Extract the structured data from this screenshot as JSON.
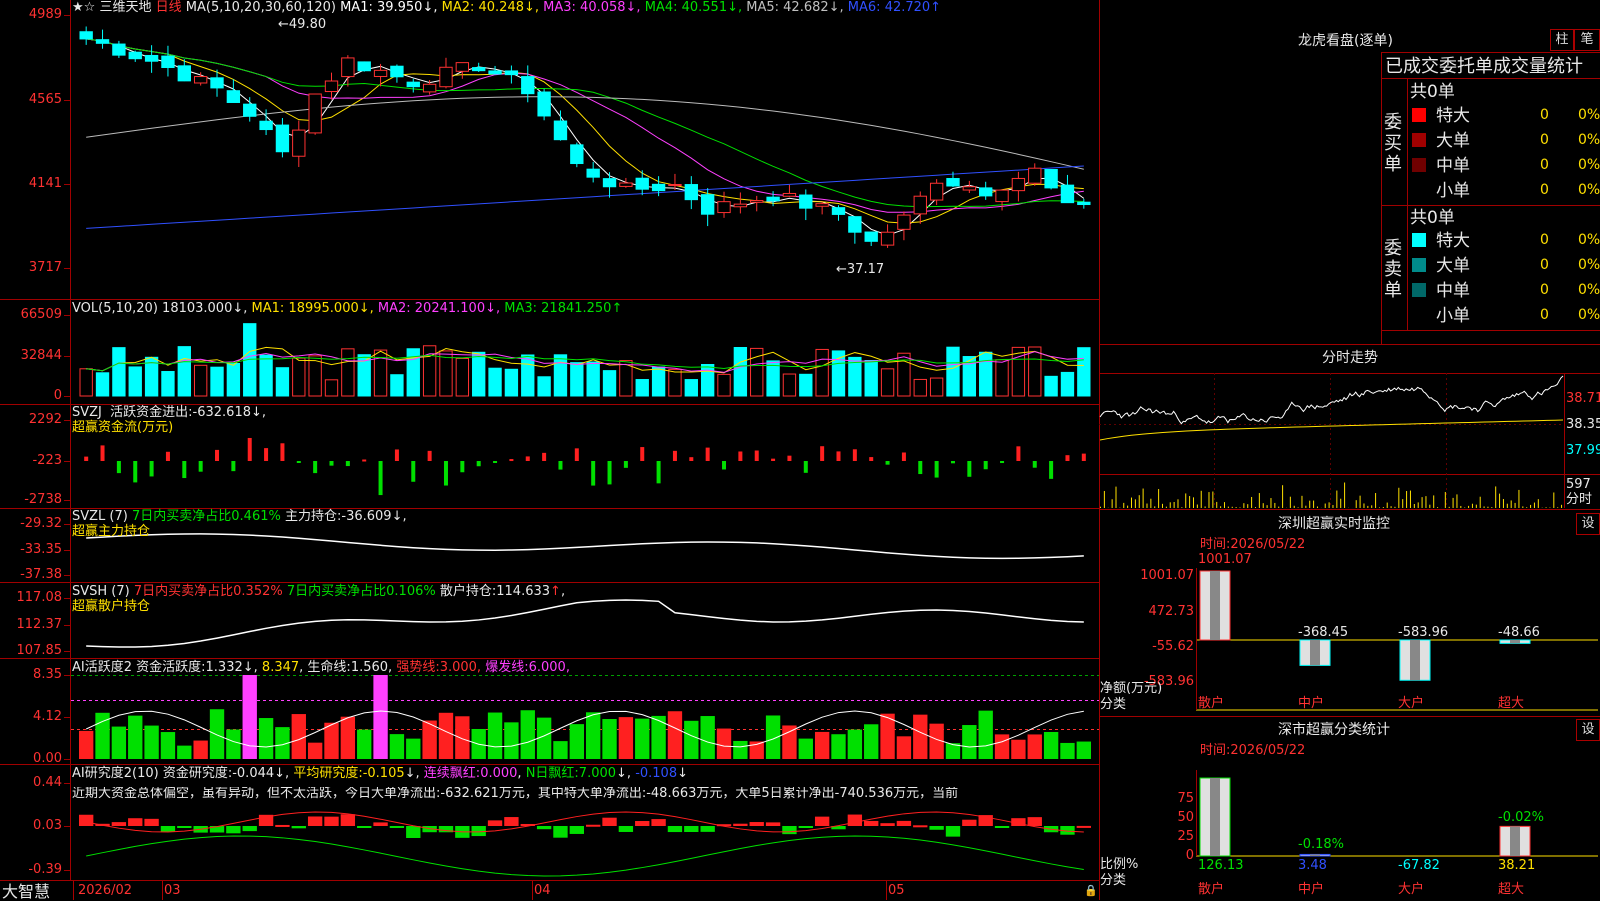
{
  "stock": {
    "name": "三维天地",
    "period": "日线",
    "star": "★",
    "star2": "☆"
  },
  "main_panel": {
    "ma_params": "MA(5,10,20,30,60,120)",
    "ma": [
      {
        "label": "MA1:",
        "value": "39.950",
        "arrow": "↓",
        "color": "#ffffff"
      },
      {
        "label": "MA2:",
        "value": "40.248",
        "arrow": "↓",
        "color": "#ffe000"
      },
      {
        "label": "MA3:",
        "value": "40.058",
        "arrow": "↓",
        "color": "#ff40ff"
      },
      {
        "label": "MA4:",
        "value": "40.551",
        "arrow": "↓",
        "color": "#00e000"
      },
      {
        "label": "MA5:",
        "value": "42.682",
        "arrow": "↓",
        "color": "#c0c0c0"
      },
      {
        "label": "MA6:",
        "value": "42.720",
        "arrow": "↑",
        "color": "#3050ff"
      }
    ],
    "yticks": [
      "4989",
      "4565",
      "4141",
      "3717"
    ],
    "high_mark": "49.80",
    "low_mark": "37.17"
  },
  "vol_panel": {
    "title": "VOL(5,10,20)",
    "value": "18103.000",
    "arrow": "↓",
    "ma": [
      {
        "label": "MA1:",
        "value": "18995.000",
        "arrow": "↓",
        "color": "#ffe000"
      },
      {
        "label": "MA2:",
        "value": "20241.100",
        "arrow": "↓",
        "color": "#ff40ff"
      },
      {
        "label": "MA3:",
        "value": "21841.250",
        "arrow": "↑",
        "color": "#00e000"
      }
    ],
    "yticks": [
      "66509",
      "32844",
      "0"
    ]
  },
  "svzj_panel": {
    "title": "SVZJ",
    "label": "活跃资金进出:",
    "value": "-632.618",
    "arrow": "↓",
    "sub": "超赢资金流(万元)",
    "yticks": [
      "2292",
      "-223",
      "-2738"
    ]
  },
  "svzl_panel": {
    "title": "SVZL (7)",
    "label1": "7日内买卖净占比",
    "value1": "0.461%",
    "label2": "主力持仓:",
    "value2": "-36.609",
    "arrow": "↓",
    "sub": "超赢主力持仓",
    "yticks": [
      "-29.32",
      "-33.35",
      "-37.38"
    ]
  },
  "svsh_panel": {
    "title": "SVSH (7)",
    "label1": "7日内买卖净占比",
    "value1": "0.352%",
    "label2": "7日内买卖净占比",
    "value2": "0.106%",
    "label3": "散户持仓:",
    "value3": "114.633",
    "arrow": "↑",
    "sub": "超赢散户持仓",
    "yticks": [
      "117.08",
      "112.37",
      "107.85"
    ]
  },
  "ai_active_panel": {
    "title": "AI活跃度2",
    "label1": "资金活跃度:",
    "value1": "1.332",
    "value2": "8.347",
    "label3": "生命线:",
    "value3": "1.560",
    "label4": "强势线:",
    "value4": "3.000",
    "label5": "爆发线:",
    "value5": "6.000",
    "yticks": [
      "8.35",
      "4.12",
      "0.00"
    ]
  },
  "ai_research_panel": {
    "title": "AI研究度2(10)",
    "label1": "资金研究度:",
    "value1": "-0.044",
    "label2": "平均研究度:",
    "value2": "-0.105",
    "label3": "连续飘红:",
    "value3": "0.000",
    "label4": "N日飘红:",
    "value4": "7.000",
    "value5": "-0.108",
    "note": "近期大资金总体偏空，虽有异动，但不太活跃，今日大单净流出:-632.621万元，其中特大单净流出:-48.663万元，大单5日累计净出-740.536万元，当前",
    "yticks": [
      "0.44",
      "0.03",
      "-0.39"
    ]
  },
  "xaxis": {
    "brand": "大智慧",
    "labels": [
      "2026/02",
      "03",
      "04",
      "05"
    ]
  },
  "lhb": {
    "title": "龙虎看盘(逐单)",
    "btn1": "柱",
    "btn2": "笔",
    "tabs": [
      "已成交",
      "委托单",
      "成交量统计"
    ],
    "buy": {
      "side": "委买单",
      "total": "共0单",
      "rows": [
        {
          "name": "特大",
          "count": "0",
          "pct": "0%",
          "color": "#ff0000"
        },
        {
          "name": "大单",
          "count": "0",
          "pct": "0%",
          "color": "#a00000"
        },
        {
          "name": "中单",
          "count": "0",
          "pct": "0%",
          "color": "#700000"
        },
        {
          "name": "小单",
          "count": "0",
          "pct": "0%",
          "color": ""
        }
      ]
    },
    "sell": {
      "side": "委卖单",
      "total": "共0单",
      "rows": [
        {
          "name": "特大",
          "count": "0",
          "pct": "0%",
          "color": "#00ffff"
        },
        {
          "name": "大单",
          "count": "0",
          "pct": "0%",
          "color": "#008b8b"
        },
        {
          "name": "中单",
          "count": "0",
          "pct": "0%",
          "color": "#006868"
        },
        {
          "name": "小单",
          "count": "0",
          "pct": "0%",
          "color": ""
        }
      ]
    }
  },
  "intraday": {
    "title": "分时走势",
    "yticks": [
      "38.71",
      "38.35",
      "37.99"
    ],
    "vol": "597",
    "vol_label": "分时"
  },
  "sz_monitor": {
    "title": "深圳超赢实时监控",
    "btn": "设",
    "time_label": "时间:",
    "date": "2026/05/22",
    "yticks": [
      "1001.07",
      "472.73",
      "-55.62",
      "-583.96"
    ],
    "ylabel": "净额(万元)",
    "xlabel": "分类",
    "cats": [
      "散户",
      "中户",
      "大户",
      "超大"
    ],
    "values": [
      1001.07,
      -368.45,
      -583.96,
      -48.66
    ],
    "value_labels": [
      "1001.07",
      "-368.45",
      "-583.96",
      "-48.66"
    ]
  },
  "sz_class": {
    "title": "深市超赢分类统计",
    "btn": "设",
    "time_label": "时间:",
    "date": "2026/05/22",
    "yticks": [
      "75",
      "50",
      "25",
      "0"
    ],
    "ylabel": "比例%",
    "xlabel": "分类",
    "cats": [
      "散户",
      "中户",
      "大户",
      "超大"
    ],
    "bottom_values": [
      "126.13",
      "3.48",
      "-67.82",
      "38.21"
    ],
    "bar_labels": [
      "",
      "-0.18%",
      "",
      "-0.02%"
    ]
  }
}
